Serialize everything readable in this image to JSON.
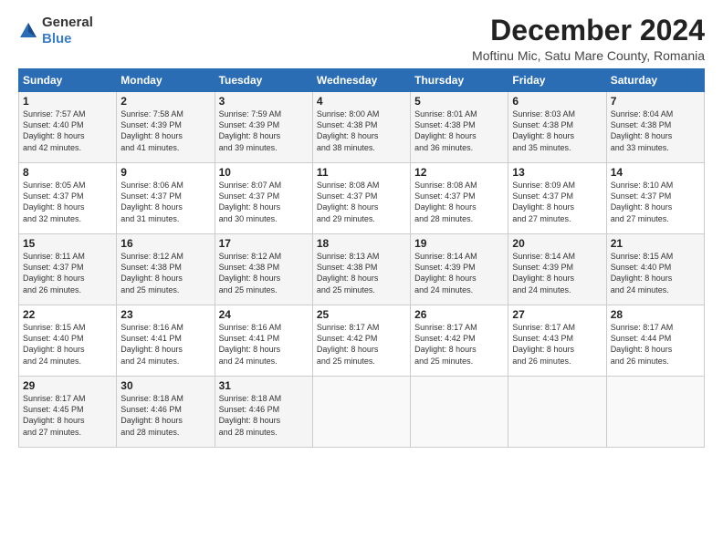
{
  "logo": {
    "general": "General",
    "blue": "Blue"
  },
  "title": "December 2024",
  "location": "Moftinu Mic, Satu Mare County, Romania",
  "weekdays": [
    "Sunday",
    "Monday",
    "Tuesday",
    "Wednesday",
    "Thursday",
    "Friday",
    "Saturday"
  ],
  "weeks": [
    [
      {
        "day": "1",
        "info": "Sunrise: 7:57 AM\nSunset: 4:40 PM\nDaylight: 8 hours\nand 42 minutes."
      },
      {
        "day": "2",
        "info": "Sunrise: 7:58 AM\nSunset: 4:39 PM\nDaylight: 8 hours\nand 41 minutes."
      },
      {
        "day": "3",
        "info": "Sunrise: 7:59 AM\nSunset: 4:39 PM\nDaylight: 8 hours\nand 39 minutes."
      },
      {
        "day": "4",
        "info": "Sunrise: 8:00 AM\nSunset: 4:38 PM\nDaylight: 8 hours\nand 38 minutes."
      },
      {
        "day": "5",
        "info": "Sunrise: 8:01 AM\nSunset: 4:38 PM\nDaylight: 8 hours\nand 36 minutes."
      },
      {
        "day": "6",
        "info": "Sunrise: 8:03 AM\nSunset: 4:38 PM\nDaylight: 8 hours\nand 35 minutes."
      },
      {
        "day": "7",
        "info": "Sunrise: 8:04 AM\nSunset: 4:38 PM\nDaylight: 8 hours\nand 33 minutes."
      }
    ],
    [
      {
        "day": "8",
        "info": "Sunrise: 8:05 AM\nSunset: 4:37 PM\nDaylight: 8 hours\nand 32 minutes."
      },
      {
        "day": "9",
        "info": "Sunrise: 8:06 AM\nSunset: 4:37 PM\nDaylight: 8 hours\nand 31 minutes."
      },
      {
        "day": "10",
        "info": "Sunrise: 8:07 AM\nSunset: 4:37 PM\nDaylight: 8 hours\nand 30 minutes."
      },
      {
        "day": "11",
        "info": "Sunrise: 8:08 AM\nSunset: 4:37 PM\nDaylight: 8 hours\nand 29 minutes."
      },
      {
        "day": "12",
        "info": "Sunrise: 8:08 AM\nSunset: 4:37 PM\nDaylight: 8 hours\nand 28 minutes."
      },
      {
        "day": "13",
        "info": "Sunrise: 8:09 AM\nSunset: 4:37 PM\nDaylight: 8 hours\nand 27 minutes."
      },
      {
        "day": "14",
        "info": "Sunrise: 8:10 AM\nSunset: 4:37 PM\nDaylight: 8 hours\nand 27 minutes."
      }
    ],
    [
      {
        "day": "15",
        "info": "Sunrise: 8:11 AM\nSunset: 4:37 PM\nDaylight: 8 hours\nand 26 minutes."
      },
      {
        "day": "16",
        "info": "Sunrise: 8:12 AM\nSunset: 4:38 PM\nDaylight: 8 hours\nand 25 minutes."
      },
      {
        "day": "17",
        "info": "Sunrise: 8:12 AM\nSunset: 4:38 PM\nDaylight: 8 hours\nand 25 minutes."
      },
      {
        "day": "18",
        "info": "Sunrise: 8:13 AM\nSunset: 4:38 PM\nDaylight: 8 hours\nand 25 minutes."
      },
      {
        "day": "19",
        "info": "Sunrise: 8:14 AM\nSunset: 4:39 PM\nDaylight: 8 hours\nand 24 minutes."
      },
      {
        "day": "20",
        "info": "Sunrise: 8:14 AM\nSunset: 4:39 PM\nDaylight: 8 hours\nand 24 minutes."
      },
      {
        "day": "21",
        "info": "Sunrise: 8:15 AM\nSunset: 4:40 PM\nDaylight: 8 hours\nand 24 minutes."
      }
    ],
    [
      {
        "day": "22",
        "info": "Sunrise: 8:15 AM\nSunset: 4:40 PM\nDaylight: 8 hours\nand 24 minutes."
      },
      {
        "day": "23",
        "info": "Sunrise: 8:16 AM\nSunset: 4:41 PM\nDaylight: 8 hours\nand 24 minutes."
      },
      {
        "day": "24",
        "info": "Sunrise: 8:16 AM\nSunset: 4:41 PM\nDaylight: 8 hours\nand 24 minutes."
      },
      {
        "day": "25",
        "info": "Sunrise: 8:17 AM\nSunset: 4:42 PM\nDaylight: 8 hours\nand 25 minutes."
      },
      {
        "day": "26",
        "info": "Sunrise: 8:17 AM\nSunset: 4:42 PM\nDaylight: 8 hours\nand 25 minutes."
      },
      {
        "day": "27",
        "info": "Sunrise: 8:17 AM\nSunset: 4:43 PM\nDaylight: 8 hours\nand 26 minutes."
      },
      {
        "day": "28",
        "info": "Sunrise: 8:17 AM\nSunset: 4:44 PM\nDaylight: 8 hours\nand 26 minutes."
      }
    ],
    [
      {
        "day": "29",
        "info": "Sunrise: 8:17 AM\nSunset: 4:45 PM\nDaylight: 8 hours\nand 27 minutes."
      },
      {
        "day": "30",
        "info": "Sunrise: 8:18 AM\nSunset: 4:46 PM\nDaylight: 8 hours\nand 28 minutes."
      },
      {
        "day": "31",
        "info": "Sunrise: 8:18 AM\nSunset: 4:46 PM\nDaylight: 8 hours\nand 28 minutes."
      },
      {
        "day": "",
        "info": ""
      },
      {
        "day": "",
        "info": ""
      },
      {
        "day": "",
        "info": ""
      },
      {
        "day": "",
        "info": ""
      }
    ]
  ]
}
